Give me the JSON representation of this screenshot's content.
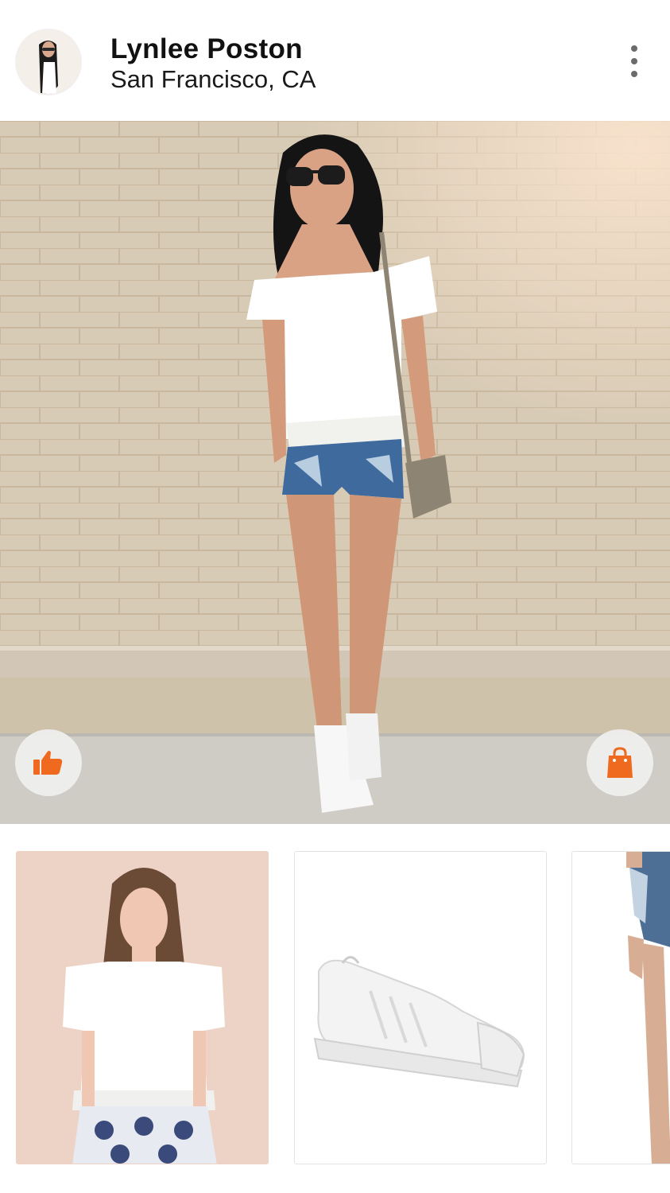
{
  "header": {
    "user_name": "Lynlee Poston",
    "location": "San Francisco, CA",
    "avatar_icon": "profile-photo",
    "menu_icon": "more-vertical-icon"
  },
  "post": {
    "photo_icon": "outfit-photo",
    "like_icon": "thumbs-up-icon",
    "shop_icon": "shopping-bag-icon"
  },
  "products": [
    {
      "icon": "lace-top-product-photo"
    },
    {
      "icon": "white-sneaker-product-photo"
    },
    {
      "icon": "denim-shorts-product-photo"
    }
  ],
  "colors": {
    "accent": "#ef6a1f",
    "brick_wall": "#d9ccb6",
    "fab_background": "#eeeeee",
    "card_border": "#e3e3e3"
  }
}
